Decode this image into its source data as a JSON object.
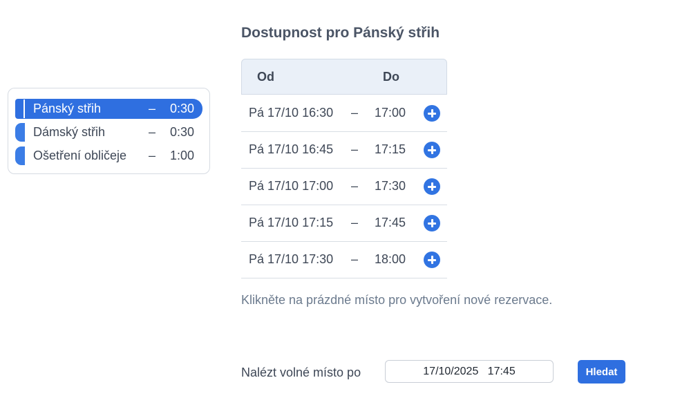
{
  "services": [
    {
      "name": "Pánský střih",
      "dash": "–",
      "duration": "0:30",
      "active": true
    },
    {
      "name": "Dámský střih",
      "dash": "–",
      "duration": "0:30",
      "active": false
    },
    {
      "name": "Ošetření obličeje",
      "dash": "–",
      "duration": "1:00",
      "active": false
    }
  ],
  "availability": {
    "title": "Dostupnost pro Pánský střih",
    "columns": {
      "from": "Od",
      "to": "Do"
    },
    "slots": [
      {
        "from": "Pá 17/10 16:30",
        "dash": "–",
        "to": "17:00"
      },
      {
        "from": "Pá 17/10 16:45",
        "dash": "–",
        "to": "17:15"
      },
      {
        "from": "Pá 17/10 17:00",
        "dash": "–",
        "to": "17:30"
      },
      {
        "from": "Pá 17/10 17:15",
        "dash": "–",
        "to": "17:45"
      },
      {
        "from": "Pá 17/10 17:30",
        "dash": "–",
        "to": "18:00"
      }
    ],
    "hint": "Klikněte na prázdné místo pro vytvoření nové rezervace."
  },
  "finder": {
    "label": "Nalézt volné místo po",
    "value": "17/10/2025   17:45",
    "button": "Hledat"
  },
  "colors": {
    "accent": "#2f6fe0",
    "add_icon": "#3174e2",
    "header_bg": "#eaf0f8"
  },
  "icons": {
    "add_slot": "plus-circle-icon"
  }
}
